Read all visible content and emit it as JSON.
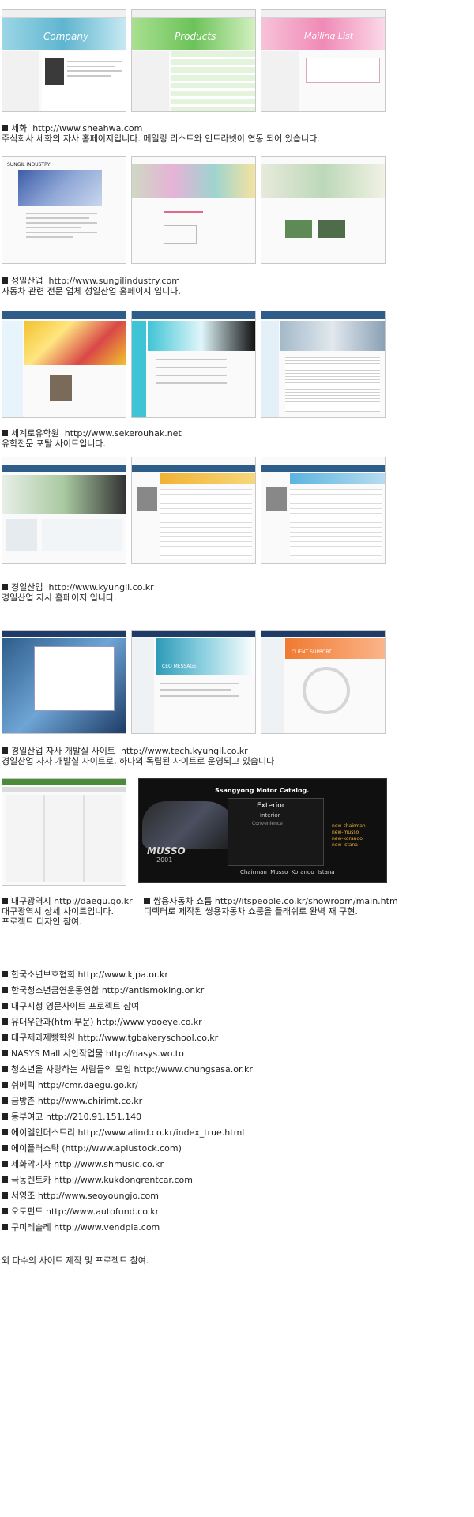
{
  "sections": [
    {
      "title": "세화",
      "url": "http://www.sheahwa.com",
      "desc": "주식회사 세화의 자사 홈페이지입니다. 메일링 리스트와 인트라넷이 연동 되어 있습니다."
    },
    {
      "title": "성일산업",
      "url": "http://www.sungilindustry.com",
      "desc": "자동차 관련 전문 업체 성일산업 홈페이지 입니다."
    },
    {
      "title": "세계로유학원",
      "url": "http://www.sekerouhak.net",
      "desc": "유학전문 포탈 사이트입니다."
    },
    {
      "title": "경일산업",
      "url": "http://www.kyungil.co.kr",
      "desc": "경일산업 자사 홈페이지 입니다."
    },
    {
      "title": "경일산업 자사 개발실 사이트",
      "url": "http://www.tech.kyungil.co.kr",
      "desc": "경일산업 자사 개발실 사이트로, 하나의 독립된 사이트로 운영되고 있습니다"
    }
  ],
  "shot_labels": {
    "sheahwa_company": "Company",
    "sheahwa_products": "Products",
    "sheahwa_mailing": "Mailing List",
    "sungil_logo": "SUNGIL INDUSTRY",
    "ssangyong_brand": "Ssangyong Motor Catalog.",
    "ssangyong_exterior": "Exterior",
    "ssangyong_interior": "Interior",
    "ssangyong_convenience": "Convenience",
    "ssangyong_model": "MUSSO",
    "ssangyong_year": "2001",
    "ssangyong_models_bar": "Chairman  Musso  Korando  Istana",
    "ssangyong_new1": "new-chairman",
    "ssangyong_new2": "new-musso",
    "ssangyong_new3": "new-korando",
    "ssangyong_new4": "new-istana",
    "tech_client": "CLIENT SUPPORT",
    "tech_ceo": "CEO MESSAGE"
  },
  "daegu": {
    "title": "대구광역시",
    "url": "http://daegu.go.kr",
    "desc1": "대구광역시 상세 사이트입니다.",
    "desc2": "프로젝트 디자인 참여."
  },
  "ssangyong": {
    "title": "쌍용자동차 쇼룸",
    "url": "http://itspeople.co.kr/showroom/main.htm",
    "desc": "디렉터로 제작된 쌍용자동차 쇼룸을 플래쉬로 완벽 재 구현."
  },
  "projects": [
    "한국소년보호협회 http://www.kjpa.or.kr",
    "한국청소년금연운동연합 http://antismoking.or.kr",
    "대구시청 영문사이트 프로젝트 참여",
    "유대우안과(html부문) http://www.yooeye.co.kr",
    "대구제과제빵학원 http://www.tgbakeryschool.co.kr",
    "NASYS Mall 시안작업물 http://nasys.wo.to",
    "청소년을 사랑하는 사람들의 모임 http://www.chungsasa.or.kr",
    "쉬메릭 http://cmr.daegu.go.kr/",
    "금방촌 http://www.chirimt.co.kr",
    "동부여고 http://210.91.151.140",
    "에이엘인더스트리 http://www.alind.co.kr/index_true.html",
    "에이플러스탁 (http://www.aplustock.com)",
    "세화악기사 http://www.shmusic.co.kr",
    "극동렌트카 http://www.kukdongrentcar.com",
    "서영조 http://www.seoyoungjo.com",
    "오토펀드 http://www.autofund.co.kr",
    "구미레솔레 http://www.vendpia.com"
  ],
  "footer": "외 다수의 사이트 제작 및 프로젝트 참여.",
  "colors": {
    "sheahwa_teal": "#7fc6d8",
    "sheahwa_green": "#8fd07a",
    "sheahwa_pink": "#f2a3c4",
    "seker_yellow": "#f2c12e",
    "seker_cyan": "#3fc4d6",
    "kyungil_navy": "#2f5d8a",
    "tech_orange": "#f07a30",
    "ssangyong_dark": "#101010"
  }
}
